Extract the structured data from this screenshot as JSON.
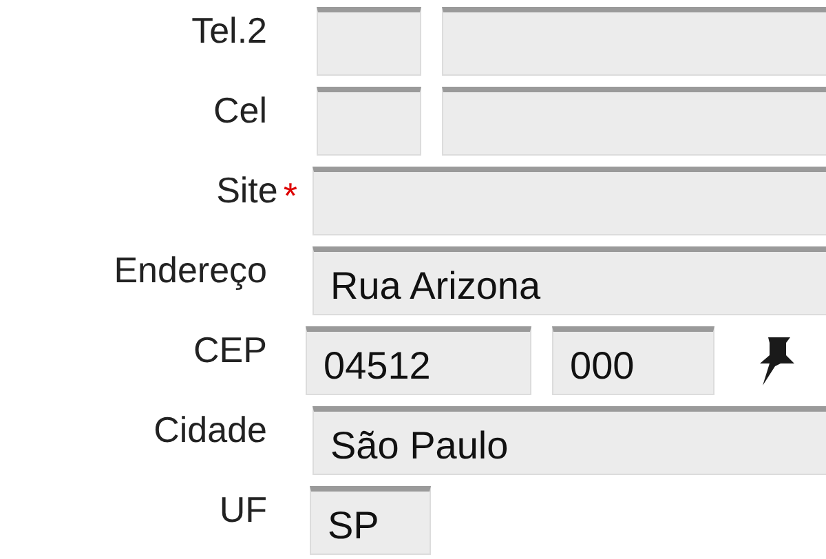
{
  "rows": [
    {
      "kind": "phone",
      "label": "Tel.2"
    },
    {
      "kind": "phone",
      "label": "Cel"
    },
    {
      "kind": "wide",
      "label": "Site",
      "required_mark": "*"
    },
    {
      "kind": "wide",
      "label": "Endereço",
      "values": [
        "Rua Arizona"
      ]
    },
    {
      "kind": "cep",
      "label": "CEP",
      "values": [
        "04512",
        "000"
      ]
    },
    {
      "kind": "wide",
      "label": "Cidade",
      "values": [
        "São Paulo"
      ]
    },
    {
      "kind": "uf",
      "label": "UF",
      "values": [
        "SP"
      ]
    }
  ]
}
